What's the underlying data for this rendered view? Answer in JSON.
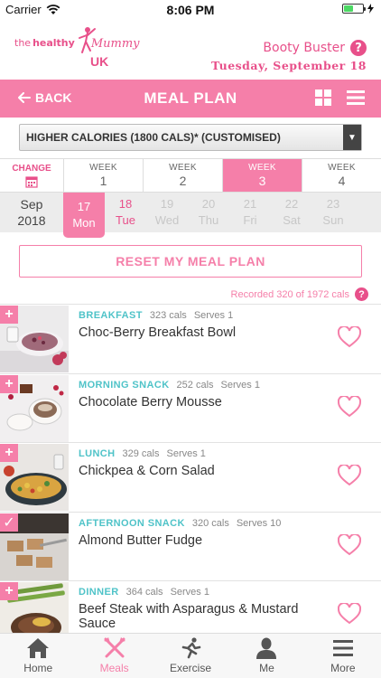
{
  "status": {
    "carrier": "Carrier",
    "time": "8:06 PM",
    "battery_level": 0.5
  },
  "brand": {
    "logo_text_1": "the",
    "logo_text_2": "healthy",
    "logo_script": "Mummy",
    "logo_uk": "UK",
    "program": "Booty Buster",
    "help": "?",
    "date": "Tuesday, September 18"
  },
  "nav": {
    "back_label": "BACK",
    "title": "MEAL PLAN"
  },
  "plan_select": {
    "value": "HIGHER CALORIES (1800 CALS)* (CUSTOMISED)"
  },
  "weeks": {
    "change_label": "CHANGE",
    "items": [
      {
        "label": "WEEK",
        "num": "1"
      },
      {
        "label": "WEEK",
        "num": "2"
      },
      {
        "label": "WEEK",
        "num": "3"
      },
      {
        "label": "WEEK",
        "num": "4"
      }
    ],
    "active_index": 2
  },
  "days": {
    "month": "Sep",
    "year": "2018",
    "items": [
      {
        "num": "17",
        "name": "Mon"
      },
      {
        "num": "18",
        "name": "Tue"
      },
      {
        "num": "19",
        "name": "Wed"
      },
      {
        "num": "20",
        "name": "Thu"
      },
      {
        "num": "21",
        "name": "Fri"
      },
      {
        "num": "22",
        "name": "Sat"
      },
      {
        "num": "23",
        "name": "Sun"
      }
    ],
    "selected_index": 0,
    "today_index": 1
  },
  "reset_label": "RESET MY MEAL PLAN",
  "recorded_text": "Recorded 320 of 1972 cals",
  "meals": [
    {
      "type": "BREAKFAST",
      "cals": "323 cals",
      "serves": "Serves 1",
      "name": "Choc-Berry Breakfast Bowl",
      "badge": "+",
      "badge_icon": "plus-icon"
    },
    {
      "type": "MORNING SNACK",
      "cals": "252 cals",
      "serves": "Serves 1",
      "name": "Chocolate Berry Mousse",
      "badge": "+",
      "badge_icon": "plus-icon"
    },
    {
      "type": "LUNCH",
      "cals": "329 cals",
      "serves": "Serves 1",
      "name": "Chickpea & Corn Salad",
      "badge": "+",
      "badge_icon": "plus-icon"
    },
    {
      "type": "AFTERNOON SNACK",
      "cals": "320 cals",
      "serves": "Serves 10",
      "name": "Almond Butter Fudge",
      "badge": "✓",
      "badge_icon": "check-icon"
    },
    {
      "type": "DINNER",
      "cals": "364 cals",
      "serves": "Serves 1",
      "name": "Beef Steak with Asparagus & Mustard Sauce",
      "badge": "+",
      "badge_icon": "plus-icon"
    }
  ],
  "tabs": [
    {
      "label": "Home",
      "icon": "home-icon"
    },
    {
      "label": "Meals",
      "icon": "cutlery-icon"
    },
    {
      "label": "Exercise",
      "icon": "runner-icon"
    },
    {
      "label": "Me",
      "icon": "person-icon"
    },
    {
      "label": "More",
      "icon": "menu-icon"
    }
  ],
  "active_tab": 1,
  "colors": {
    "pink": "#f57fa9",
    "brand_pink": "#e8508a",
    "teal": "#4fc3c8"
  }
}
